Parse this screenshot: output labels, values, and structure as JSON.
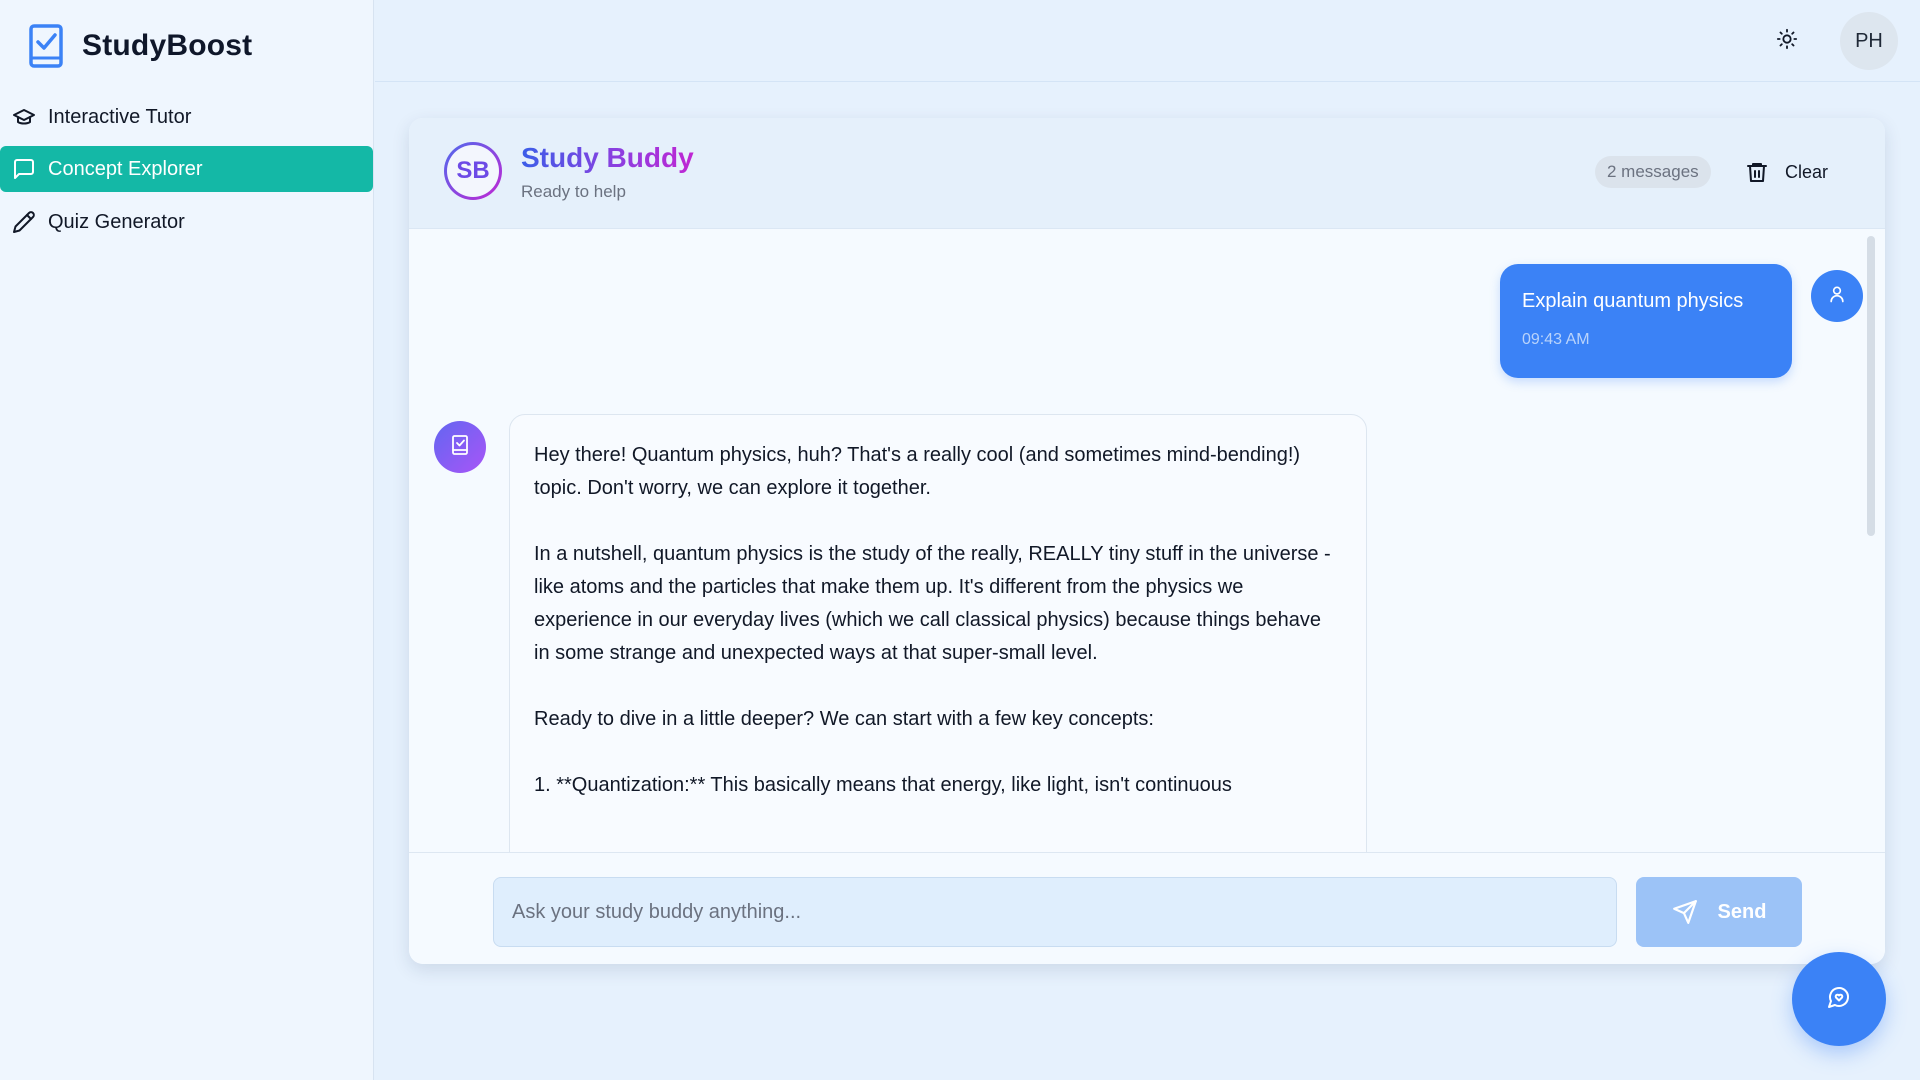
{
  "app": {
    "name": "StudyBoost"
  },
  "sidebar": {
    "items": [
      {
        "label": "Interactive Tutor",
        "icon": "graduation-cap-icon",
        "active": false
      },
      {
        "label": "Concept Explorer",
        "icon": "message-square-icon",
        "active": true
      },
      {
        "label": "Quiz Generator",
        "icon": "pencil-icon",
        "active": false
      }
    ]
  },
  "header": {
    "theme_icon": "sun-icon",
    "user_initials": "PH"
  },
  "chat": {
    "bot_initials": "SB",
    "bot_name": "Study Buddy",
    "bot_status": "Ready to help",
    "message_count": "2 messages",
    "clear_label": "Clear",
    "messages": [
      {
        "role": "user",
        "text": "Explain quantum physics",
        "time": "09:43 AM"
      },
      {
        "role": "assistant",
        "paragraphs": [
          "Hey there! Quantum physics, huh? That's a really cool (and sometimes mind-bending!) topic. Don't worry, we can explore it together.",
          "In a nutshell, quantum physics is the study of the really, REALLY tiny stuff in the universe - like atoms and the particles that make them up. It's different from the physics we experience in our everyday lives (which we call classical physics) because things behave in some strange and unexpected ways at that super-small level.",
          "Ready to dive in a little deeper? We can start with a few key concepts:",
          "1.  **Quantization:** This basically means that energy, like light, isn't continuous"
        ]
      }
    ],
    "input_placeholder": "Ask your study buddy anything...",
    "input_value": "",
    "send_label": "Send"
  },
  "colors": {
    "accent_teal": "#14b8a6",
    "primary_blue": "#3b82f6",
    "send_disabled": "#9cc3f7",
    "page_bg": "#e6f1fd"
  }
}
